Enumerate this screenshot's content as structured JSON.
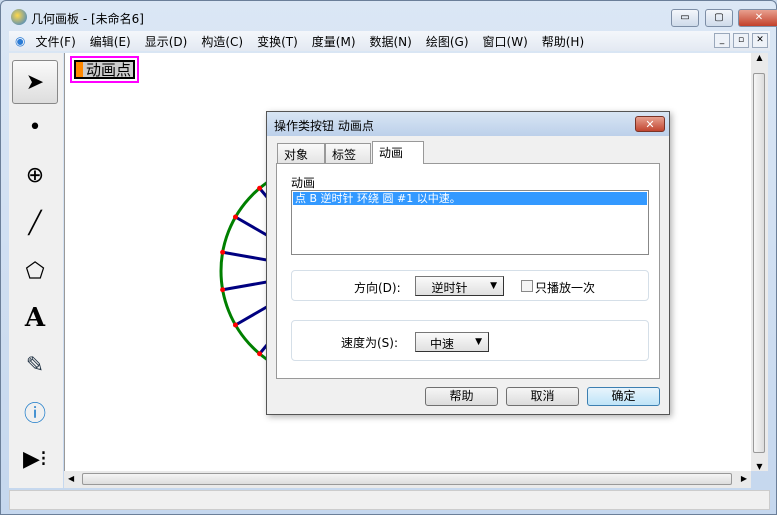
{
  "window": {
    "title": "几何画板 - [未命名6]",
    "minimize": "▭",
    "maximize": "▢",
    "close": "✕"
  },
  "menu": [
    "文件(F)",
    "编辑(E)",
    "显示(D)",
    "构造(C)",
    "变换(T)",
    "度量(M)",
    "数据(N)",
    "绘图(G)",
    "窗口(W)",
    "帮助(H)"
  ],
  "canvas": {
    "action_button_label": "动画点"
  },
  "dialog": {
    "title": "操作类按钮 动画点",
    "tabs": [
      "对象",
      "标签",
      "动画"
    ],
    "active_tab": "动画",
    "section_label": "动画",
    "list_items": [
      "点 B 逆时针 环绕 圆 #1 以中速。"
    ],
    "direction_label": "方向(D):",
    "direction_value": "逆时针",
    "once_label": "只播放一次",
    "once_checked": false,
    "speed_label": "速度为(S):",
    "speed_value": "中速",
    "buttons": {
      "help": "帮助",
      "cancel": "取消",
      "ok": "确定"
    }
  },
  "colors": {
    "circle": "#008000",
    "spoke": "#000080",
    "point": "#ff0000",
    "highlight": "#ff00ff",
    "button_bar": "#ff8800"
  }
}
